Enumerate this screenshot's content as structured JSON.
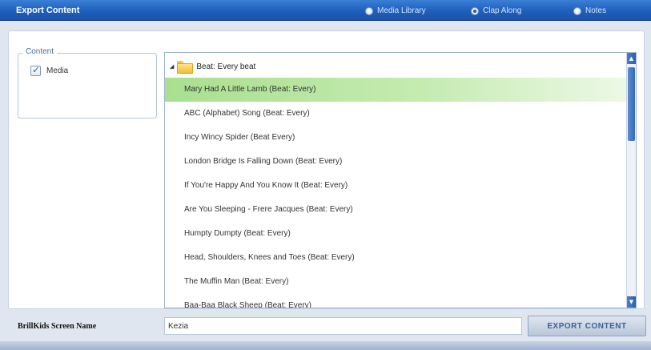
{
  "window": {
    "title": "Export Content",
    "radios": [
      {
        "label": "Media Library",
        "selected": false
      },
      {
        "label": "Clap Along",
        "selected": true
      },
      {
        "label": "Notes",
        "selected": false
      }
    ]
  },
  "content_group": {
    "legend": "Content",
    "checkbox": {
      "label": "Media",
      "checked": true
    }
  },
  "tree": {
    "root_label": "Beat: Every beat",
    "items": [
      "Mary Had A Little Lamb (Beat: Every)",
      "ABC (Alphabet) Song (Beat: Every)",
      "Incy Wincy Spider (Beat Every)",
      "London Bridge Is Falling Down (Beat: Every)",
      "If You're Happy And You Know It (Beat: Every)",
      "Are You Sleeping - Frere Jacques (Beat: Every)",
      "Humpty Dumpty (Beat: Every)",
      "Head, Shoulders, Knees and Toes (Beat: Every)",
      "The Muffin Man (Beat: Every)",
      "Baa-Baa Black Sheep (Beat: Every)"
    ],
    "selected_index": 0
  },
  "footer": {
    "screen_name_label": "BrillKids Screen Name",
    "screen_name_value": "Kezia",
    "export_button": "EXPORT CONTENT"
  },
  "icons": {
    "folder": "folder-icon",
    "expander": "triangle-expander-icon",
    "check": "checkmark-icon"
  }
}
